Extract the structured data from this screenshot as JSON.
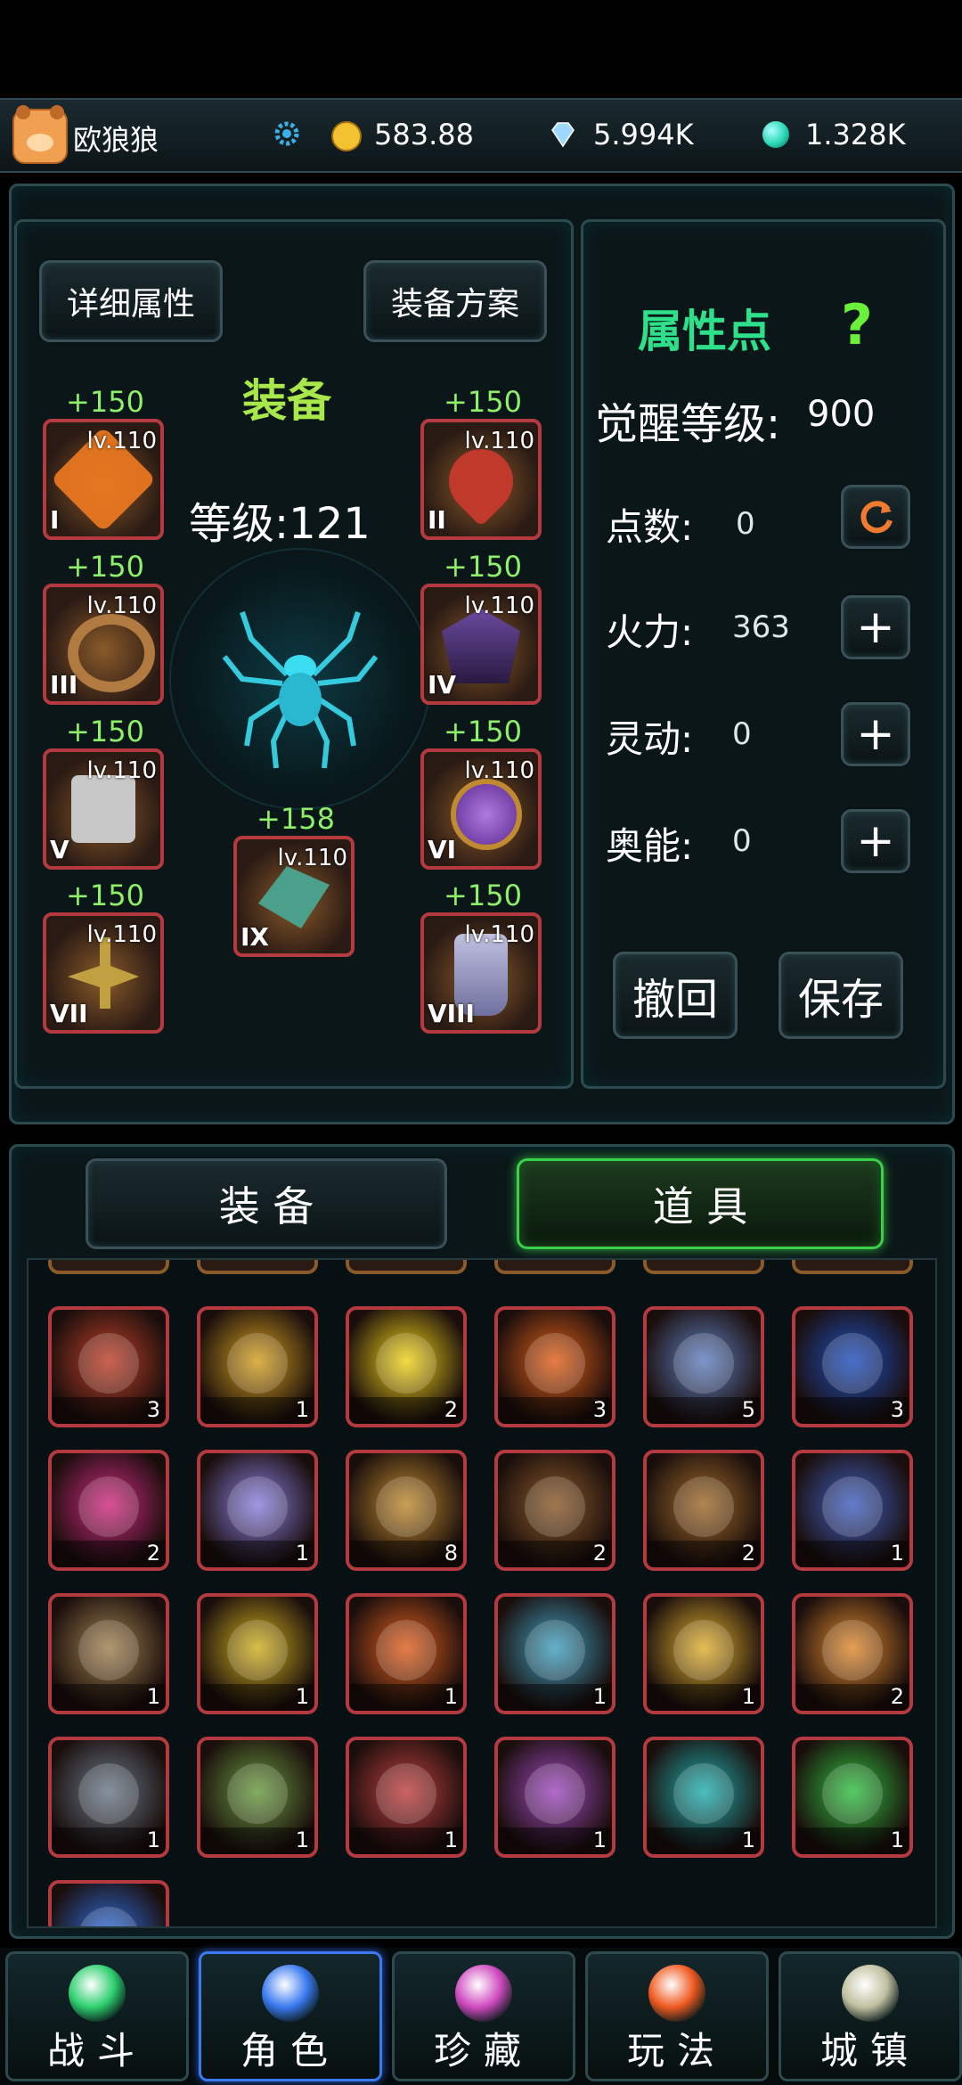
{
  "player": {
    "name": "欧狼狼"
  },
  "currencies": [
    {
      "icon": "gold-coin-icon",
      "value": "583.88",
      "color": "#f2c230"
    },
    {
      "icon": "diamond-icon",
      "value": "5.994K",
      "color": "#9fd8ff"
    },
    {
      "icon": "jade-orb-icon",
      "value": "1.328K",
      "color": "#29d6b4"
    }
  ],
  "equipment_panel": {
    "details_button": "详细属性",
    "scheme_button": "装备方案",
    "title": "装备",
    "level_label": "等级:121",
    "slots": [
      {
        "roman": "I",
        "level": "lv.110",
        "bonus": "+150",
        "color": "#f07a20"
      },
      {
        "roman": "II",
        "level": "lv.110",
        "bonus": "+150",
        "color": "#c0392b"
      },
      {
        "roman": "III",
        "level": "lv.110",
        "bonus": "+150",
        "color": "#b07a40"
      },
      {
        "roman": "IV",
        "level": "lv.110",
        "bonus": "+150",
        "color": "#6a4aa0"
      },
      {
        "roman": "V",
        "level": "lv.110",
        "bonus": "+150",
        "color": "#8a8a8a"
      },
      {
        "roman": "VI",
        "level": "lv.110",
        "bonus": "+150",
        "color": "#7a4ab0"
      },
      {
        "roman": "VII",
        "level": "lv.110",
        "bonus": "+150",
        "color": "#c0a040"
      },
      {
        "roman": "VIII",
        "level": "lv.110",
        "bonus": "+150",
        "color": "#9090b0"
      },
      {
        "roman": "IX",
        "level": "lv.110",
        "bonus": "+158",
        "color": "#4aa08a"
      }
    ]
  },
  "attribute_panel": {
    "title": "属性点",
    "help_icon": "?",
    "awaken_label": "觉醒等级:",
    "awaken_value": "900",
    "stats": [
      {
        "label": "点数:",
        "value": "0",
        "action": "refresh-icon"
      },
      {
        "label": "火力:",
        "value": "363",
        "action": "plus-icon"
      },
      {
        "label": "灵动:",
        "value": "0",
        "action": "plus-icon"
      },
      {
        "label": "奥能:",
        "value": "0",
        "action": "plus-icon"
      }
    ],
    "undo_button": "撤回",
    "save_button": "保存"
  },
  "inventory_tabs": {
    "equipment": "装 备",
    "items": "道 具",
    "active": "items"
  },
  "items": [
    {
      "icon": "red-book-icon",
      "count": "3",
      "color": "#c0402a"
    },
    {
      "icon": "golden-dragon-icon",
      "count": "1",
      "color": "#d4a020"
    },
    {
      "icon": "pikachu-icon",
      "count": "2",
      "color": "#f2d41a"
    },
    {
      "icon": "fire-pillar-icon",
      "count": "3",
      "color": "#e0601a"
    },
    {
      "icon": "comet-icon",
      "count": "5",
      "color": "#6080c0"
    },
    {
      "icon": "blue-vortex-icon",
      "count": "3",
      "color": "#2050c0"
    },
    {
      "icon": "pink-slash-icon",
      "count": "2",
      "color": "#d02a80"
    },
    {
      "icon": "light-hand-icon",
      "count": "1",
      "color": "#8a80e0"
    },
    {
      "icon": "rainbow-sword-icon",
      "count": "8",
      "color": "#c08a30"
    },
    {
      "icon": "bronze-armor-icon",
      "count": "2",
      "color": "#8a5a2a"
    },
    {
      "icon": "leather-book-icon",
      "count": "2",
      "color": "#a06a2a"
    },
    {
      "icon": "glowing-hands-icon",
      "count": "1",
      "color": "#4060c0"
    },
    {
      "icon": "candle-book-icon",
      "count": "1",
      "color": "#a08050"
    },
    {
      "icon": "gold-sigil-icon",
      "count": "1",
      "color": "#d0b020"
    },
    {
      "icon": "fire-sigil-icon",
      "count": "1",
      "color": "#e06020"
    },
    {
      "icon": "portal-altar-icon",
      "count": "1",
      "color": "#40a0c0"
    },
    {
      "icon": "golden-statue-icon",
      "count": "1",
      "color": "#e0b030"
    },
    {
      "icon": "lion-cub-icon",
      "count": "2",
      "color": "#e08a30"
    },
    {
      "icon": "steel-armor-icon",
      "count": "1",
      "color": "#6a7a8a"
    },
    {
      "icon": "green-tome-icon",
      "count": "1",
      "color": "#6a9a40"
    },
    {
      "icon": "mystery-scroll-icon",
      "count": "1",
      "color": "#c04040"
    },
    {
      "icon": "gem-ring-icon",
      "count": "1",
      "color": "#a04ac0"
    },
    {
      "icon": "cyan-fist-icon",
      "count": "1",
      "color": "#20b0b0"
    },
    {
      "icon": "green-spider-icon",
      "count": "1",
      "color": "#30c040"
    },
    {
      "icon": "lightning-orb-icon",
      "count": "",
      "color": "#3070e0"
    }
  ],
  "nav": [
    {
      "label": "战斗",
      "icon": "crossed-swords-icon",
      "color": "#2fd070"
    },
    {
      "label": "角色",
      "icon": "sword-emblem-icon",
      "color": "#3a7af0"
    },
    {
      "label": "珍藏",
      "icon": "treasure-icon",
      "color": "#d04ac0"
    },
    {
      "label": "玩法",
      "icon": "gameplay-icon",
      "color": "#f05a20"
    },
    {
      "label": "城镇",
      "icon": "town-icon",
      "color": "#c0c0a0"
    }
  ]
}
